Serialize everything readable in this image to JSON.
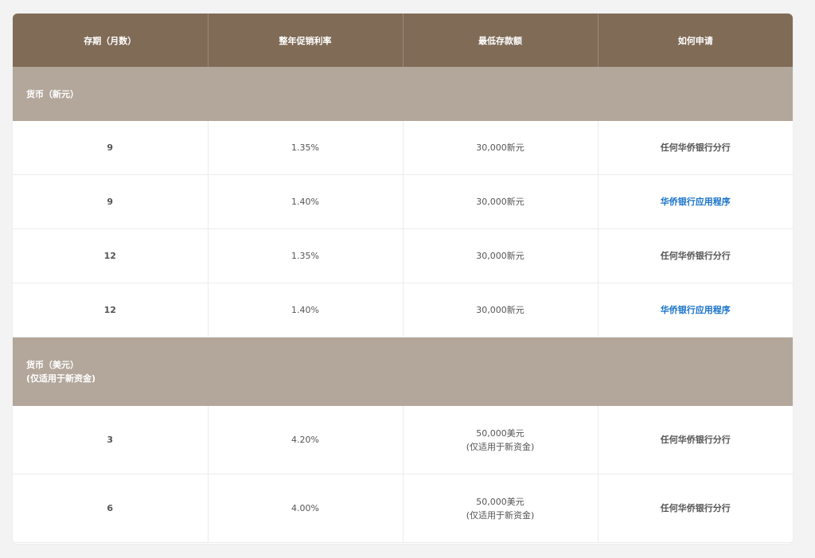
{
  "table": {
    "headers": [
      "存期（月数）",
      "整年促销利率",
      "最低存款额",
      "如何申请"
    ],
    "sections": [
      {
        "label_lines": [
          "货币（新元）"
        ],
        "rows": [
          {
            "term": "9",
            "rate": "1.35%",
            "min_lines": [
              "30,000新元"
            ],
            "method": "任何华侨银行分行",
            "method_is_link": false
          },
          {
            "term": "9",
            "rate": "1.40%",
            "min_lines": [
              "30,000新元"
            ],
            "method": "华侨银行应用程序",
            "method_is_link": true
          },
          {
            "term": "12",
            "rate": "1.35%",
            "min_lines": [
              "30,000新元"
            ],
            "method": "任何华侨银行分行",
            "method_is_link": false
          },
          {
            "term": "12",
            "rate": "1.40%",
            "min_lines": [
              "30,000新元"
            ],
            "method": "华侨银行应用程序",
            "method_is_link": true
          }
        ]
      },
      {
        "label_lines": [
          "货币（美元）",
          "(仅适用于新资金)"
        ],
        "rows": [
          {
            "term": "3",
            "rate": "4.20%",
            "min_lines": [
              "50,000美元",
              "(仅适用于新资金)"
            ],
            "method": "任何华侨银行分行",
            "method_is_link": false
          },
          {
            "term": "6",
            "rate": "4.00%",
            "min_lines": [
              "50,000美元",
              "(仅适用于新资金)"
            ],
            "method": "任何华侨银行分行",
            "method_is_link": false
          }
        ]
      }
    ]
  },
  "colors": {
    "header_bg": "#806b57",
    "section_bg": "#b3a79b",
    "link": "#1a73c9",
    "page_bg": "#f3f3f3"
  }
}
